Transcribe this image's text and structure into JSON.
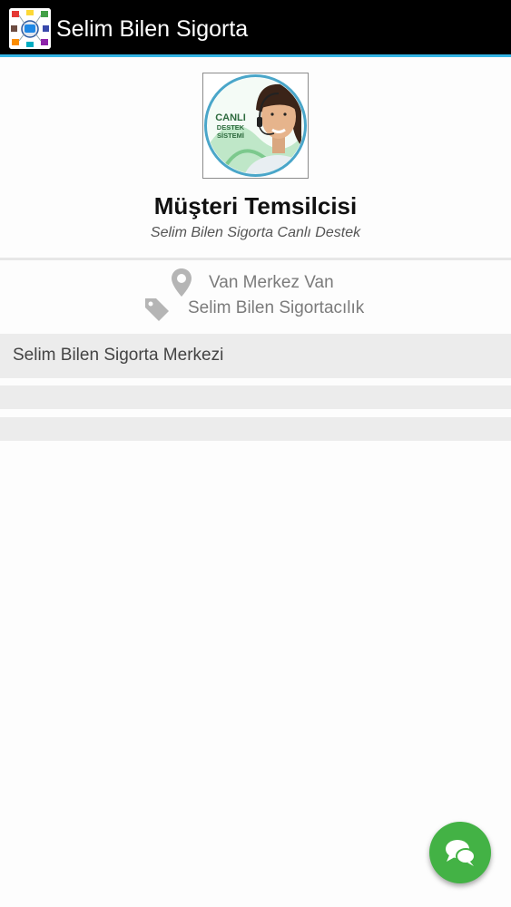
{
  "app": {
    "title": "Selim Bilen Sigorta",
    "accent_color": "#33b5e5",
    "icon": "app-logo-icon"
  },
  "profile": {
    "avatar_badge": [
      "CANLI",
      "DESTEK",
      "SİSTEMİ"
    ],
    "name": "Müşteri Temsilcisi",
    "subtitle": "Selim Bilen Sigorta Canlı Destek"
  },
  "info": {
    "location": {
      "icon": "location-pin-icon",
      "text": "Van Merkez Van"
    },
    "category": {
      "icon": "tag-icon",
      "text": "Selim Bilen Sigortacılık"
    }
  },
  "rows": [
    {
      "label": "Selim Bilen Sigorta Merkezi"
    },
    {
      "label": ""
    },
    {
      "label": ""
    }
  ],
  "fab": {
    "icon": "chat-bubbles-icon",
    "color": "#43b245"
  }
}
